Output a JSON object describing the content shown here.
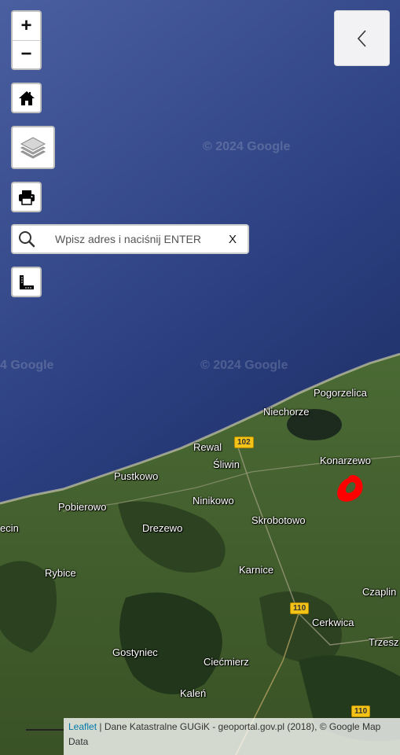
{
  "map": {
    "watermark": "© 2024 Google",
    "watermark_left": "4 Google",
    "places": [
      {
        "name": "Pogorzelica"
      },
      {
        "name": "Niechorze"
      },
      {
        "name": "Rewal"
      },
      {
        "name": "Śliwin"
      },
      {
        "name": "Konarzewo"
      },
      {
        "name": "Pustkowo"
      },
      {
        "name": "Ninikowo"
      },
      {
        "name": "Pobierowo"
      },
      {
        "name": "Skrobotowo"
      },
      {
        "name": "Drezewo"
      },
      {
        "name": "ecin"
      },
      {
        "name": "Rybice"
      },
      {
        "name": "Karnice"
      },
      {
        "name": "Czaplin"
      },
      {
        "name": "Cerkwica"
      },
      {
        "name": "Trzesz"
      },
      {
        "name": "Gostyniec"
      },
      {
        "name": "Ciećmierz"
      },
      {
        "name": "Kaleń"
      }
    ],
    "roads": [
      "102",
      "110",
      "110"
    ]
  },
  "controls": {
    "zoom_in": "+",
    "zoom_out": "−",
    "search_placeholder": "Wpisz adres i naciśnij ENTER",
    "search_clear": "X"
  },
  "attribution": {
    "leaflet": "Leaflet",
    "text": " | Dane Katastralne GUGiK - geoportal.gov.pl (2018), © Google Map Data"
  },
  "colors": {
    "sea_deep": "#1f2f66",
    "sea_mid": "#3a4e8c",
    "land": "#3f5a2c",
    "forest": "#23391c",
    "marker": "#ff0000"
  }
}
